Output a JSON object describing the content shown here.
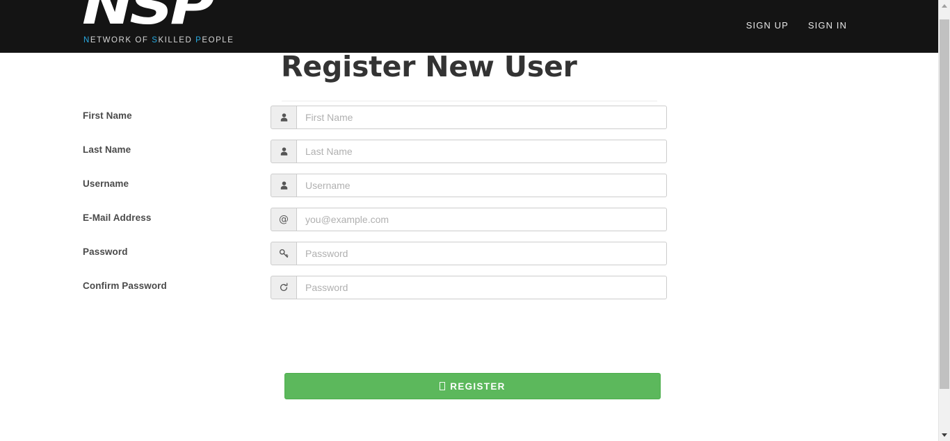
{
  "navbar": {
    "brand": {
      "mark": "NSP",
      "sub_prefix_n": "N",
      "sub_part1": "ETWORK OF ",
      "sub_s": "S",
      "sub_part2": "KILLED ",
      "sub_p": "P",
      "sub_part3": "EOPLE",
      "accent_color": "#29abe2",
      "full_subtitle": "NETWORK OF SKILLED PEOPLE"
    },
    "links": [
      {
        "label": "SIGN UP",
        "name": "sign-up"
      },
      {
        "label": "SIGN IN",
        "name": "sign-in"
      }
    ],
    "background_color": "#141414"
  },
  "main": {
    "title": "Register New User",
    "fields": [
      {
        "label": "First Name",
        "placeholder": "First Name",
        "value": "",
        "icon": "user-icon",
        "type": "text"
      },
      {
        "label": "Last Name",
        "placeholder": "Last Name",
        "value": "",
        "icon": "user-icon",
        "type": "text"
      },
      {
        "label": "Username",
        "placeholder": "Username",
        "value": "",
        "icon": "user-icon",
        "type": "text"
      },
      {
        "label": "E-Mail Address",
        "placeholder": "you@example.com",
        "value": "",
        "icon": "at-icon",
        "type": "email"
      },
      {
        "label": "Password",
        "placeholder": "Password",
        "value": "",
        "icon": "key-icon",
        "type": "password"
      },
      {
        "label": "Confirm Password",
        "placeholder": "Password",
        "value": "",
        "icon": "refresh-icon",
        "type": "password"
      }
    ],
    "submit": {
      "label": "REGISTER",
      "glyph": "missing-glyph-box",
      "color": "#5cb85c"
    }
  },
  "scrollbar": {
    "up_arrow": "scroll-up-arrow",
    "down_arrow": "scroll-down-arrow"
  }
}
